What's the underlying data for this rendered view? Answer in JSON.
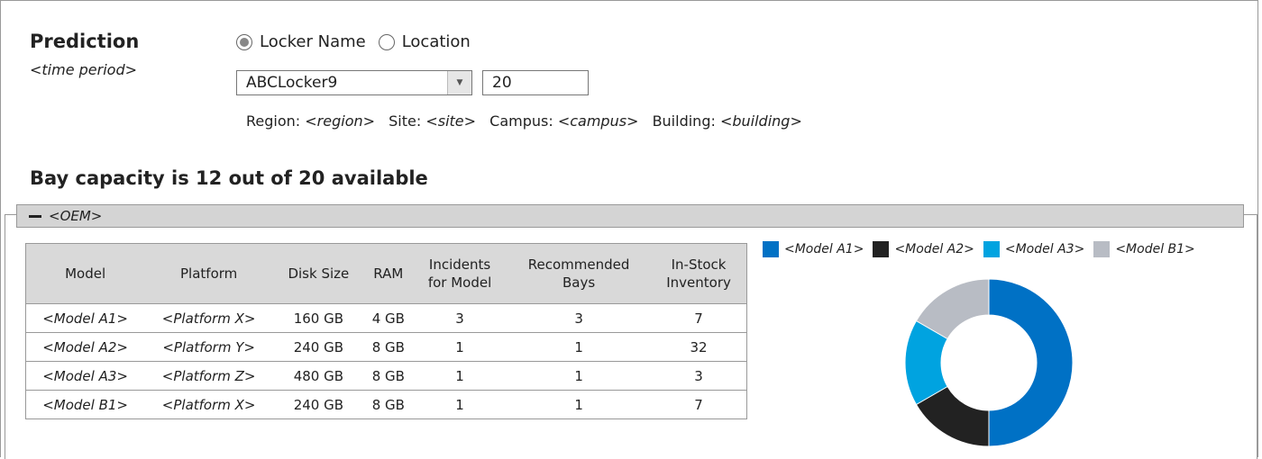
{
  "header": {
    "title": "Prediction",
    "subtitle": "<time period>"
  },
  "selector": {
    "options": [
      {
        "label": "Locker Name",
        "selected": true
      },
      {
        "label": "Location",
        "selected": false
      }
    ],
    "locker_value": "ABCLocker9",
    "count_value": "20"
  },
  "location": {
    "region_label": "Region:",
    "region": "<region>",
    "site_label": "Site:",
    "site": "<site>",
    "campus_label": "Campus:",
    "campus": "<campus>",
    "building_label": "Building:",
    "building": "<building>"
  },
  "capacity_text": "Bay capacity is 12 out of 20 available",
  "oem": {
    "label": "<OEM>"
  },
  "table": {
    "headers": [
      "Model",
      "Platform",
      "Disk Size",
      "RAM",
      "Incidents\nfor Model",
      "Recommended\nBays",
      "In-Stock\nInventory"
    ],
    "rows": [
      [
        "<Model A1>",
        "<Platform X>",
        "160 GB",
        "4 GB",
        "3",
        "3",
        "7"
      ],
      [
        "<Model A2>",
        "<Platform Y>",
        "240 GB",
        "8 GB",
        "1",
        "1",
        "32"
      ],
      [
        "<Model A3>",
        "<Platform Z>",
        "480 GB",
        "8 GB",
        "1",
        "1",
        "3"
      ],
      [
        "<Model B1>",
        "<Platform X>",
        "240 GB",
        "8 GB",
        "1",
        "1",
        "7"
      ]
    ]
  },
  "chart_data": {
    "type": "pie",
    "categories": [
      "<Model A1>",
      "<Model A2>",
      "<Model A3>",
      "<Model B1>"
    ],
    "values": [
      3,
      1,
      1,
      1
    ],
    "colors": [
      "#0071c5",
      "#222222",
      "#00a3e0",
      "#b8bcc4"
    ],
    "legend": "top"
  }
}
